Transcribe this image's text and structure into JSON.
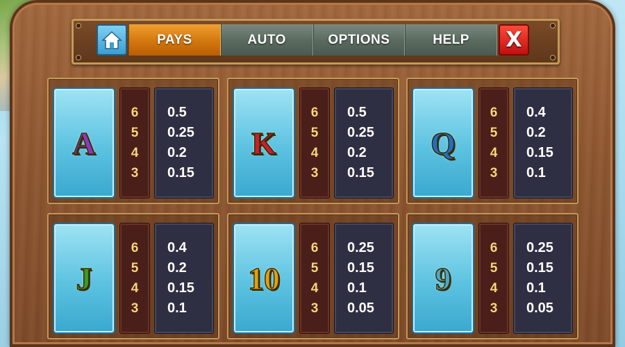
{
  "nav": {
    "home_icon": "home-icon",
    "tabs": [
      {
        "label": "PAYS",
        "active": true
      },
      {
        "label": "AUTO",
        "active": false
      },
      {
        "label": "OPTIONS",
        "active": false
      },
      {
        "label": "HELP",
        "active": false
      }
    ],
    "close_label": "X"
  },
  "colors": {
    "active_tab": "#d57a10",
    "card_bg": "#5cc2e0",
    "count_text": "#f6d77a",
    "count_bg": "#4a1f1a",
    "payout_bg": "#2e2f42"
  },
  "paytable": [
    {
      "symbol": "A",
      "color": "#8a3ab8",
      "counts": [
        "6",
        "5",
        "4",
        "3"
      ],
      "payouts": [
        "0.5",
        "0.25",
        "0.2",
        "0.15"
      ]
    },
    {
      "symbol": "K",
      "color": "#c8202a",
      "counts": [
        "6",
        "5",
        "4",
        "3"
      ],
      "payouts": [
        "0.5",
        "0.25",
        "0.2",
        "0.15"
      ]
    },
    {
      "symbol": "Q",
      "color": "#1f6fc0",
      "counts": [
        "6",
        "5",
        "4",
        "3"
      ],
      "payouts": [
        "0.4",
        "0.2",
        "0.15",
        "0.1"
      ]
    },
    {
      "symbol": "J",
      "color": "#3a9a2a",
      "counts": [
        "6",
        "5",
        "4",
        "3"
      ],
      "payouts": [
        "0.4",
        "0.2",
        "0.15",
        "0.1"
      ]
    },
    {
      "symbol": "10",
      "color": "#e0a010",
      "counts": [
        "6",
        "5",
        "4",
        "3"
      ],
      "payouts": [
        "0.25",
        "0.15",
        "0.1",
        "0.05"
      ]
    },
    {
      "symbol": "9",
      "color": "#4aa8c8",
      "counts": [
        "6",
        "5",
        "4",
        "3"
      ],
      "payouts": [
        "0.25",
        "0.15",
        "0.1",
        "0.05"
      ]
    }
  ]
}
